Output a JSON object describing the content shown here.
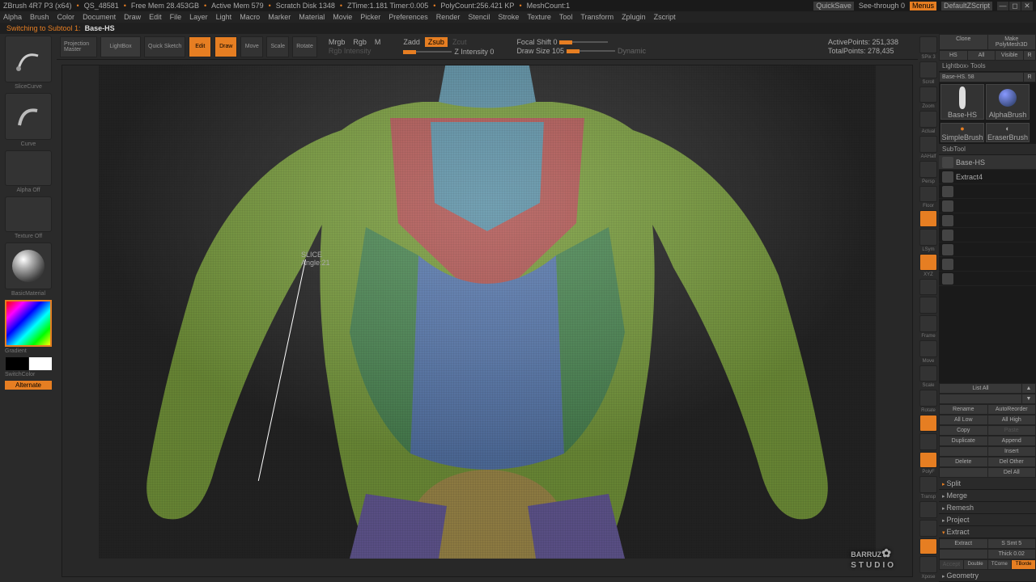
{
  "titlebar": {
    "app": "ZBrush 4R7 P3 (x64)",
    "doc": "QS_48581",
    "free_mem": "Free Mem 28.453GB",
    "active_mem": "Active Mem 579",
    "scratch": "Scratch Disk 1348",
    "ztime": "ZTime:1.181 Timer:0.005",
    "polycount": "PolyCount:256.421 KP",
    "meshcount": "MeshCount:1",
    "quicksave": "QuickSave",
    "seethrough": "See-through  0",
    "menus": "Menus",
    "script": "DefaultZScript"
  },
  "menus": [
    "Alpha",
    "Brush",
    "Color",
    "Document",
    "Draw",
    "Edit",
    "File",
    "Layer",
    "Light",
    "Macro",
    "Marker",
    "Material",
    "Movie",
    "Picker",
    "Preferences",
    "Render",
    "Stencil",
    "Stroke",
    "Texture",
    "Tool",
    "Transform",
    "Zplugin",
    "Zscript"
  ],
  "status": {
    "prefix": "Switching to Subtool 1:",
    "name": "Base-HS"
  },
  "toolbar": {
    "projection": "Projection\nMaster",
    "lightbox": "LightBox",
    "quicksketch": "Quick\nSketch",
    "edit": "Edit",
    "draw": "Draw",
    "move": "Move",
    "scale": "Scale",
    "rotate": "Rotate",
    "mrgb": "Mrgb",
    "rgb": "Rgb",
    "m": "M",
    "zadd": "Zadd",
    "zsub": "Zsub",
    "zcut": "Zcut",
    "rgb_int": "Rgb Intensity",
    "z_int": "Z Intensity 0",
    "focal": "Focal Shift 0",
    "drawsize": "Draw Size 105",
    "dynamic": "Dynamic",
    "active_pts": "ActivePoints: 251,338",
    "total_pts": "TotalPoints: 278,435"
  },
  "viewport": {
    "slice": "SLICE",
    "angle": "Angle:21"
  },
  "left": {
    "slicecurve": "SliceCurve",
    "curve": "Curve",
    "alpha_off": "Alpha Off",
    "texture_off": "Texture Off",
    "material": "BasicMaterial",
    "gradient": "Gradient",
    "switchcolor": "SwitchColor",
    "alternate": "Alternate"
  },
  "rightstrip": {
    "labels": [
      "SPix 3",
      "Scroll",
      "Zoom",
      "Actual",
      "AAHalf",
      "Persp",
      "Floor",
      "",
      "LSym",
      "XYZ",
      "",
      "",
      "Frame",
      "Move",
      "Scale",
      "Rotate",
      "",
      "",
      "PolyF",
      "Transp",
      "",
      "",
      "",
      "Xpose"
    ]
  },
  "panel": {
    "toprow": [
      "Clone",
      "Make PolyMesh3D"
    ],
    "filterrow": [
      "HS",
      "All",
      "Visible",
      "R"
    ],
    "toolsheader": "Lightbox› Tools",
    "basehs": "Base-HS. 58",
    "r": "R",
    "thumb1": "Base-HS",
    "thumb2": "AlphaBrush",
    "thumb3": "SimpleBrush",
    "thumb4": "EraserBrush",
    "subtool_hdr": "SubTool",
    "subtools": [
      "Base-HS",
      "Extract4",
      "",
      "",
      "",
      "",
      "",
      "",
      ""
    ],
    "listall": "List All",
    "btns": {
      "rename": "Rename",
      "autoreorder": "AutoReorder",
      "alllow": "All Low",
      "allhigh": "All High",
      "copy": "Copy",
      "paste": "Paste",
      "duplicate": "Duplicate",
      "append": "Append",
      "insert": "Insert",
      "delete": "Delete",
      "delother": "Del Other",
      "delall": "Del All",
      "split": "Split",
      "merge": "Merge",
      "remesh": "Remesh",
      "project": "Project",
      "extract_hdr": "Extract",
      "extract": "Extract",
      "ssmt": "S Smt 5",
      "thick": "Thick 0.02",
      "accept": "Accept",
      "double": "Double",
      "tcorne": "TCorne",
      "tborde": "TBorde",
      "geometry": "Geometry"
    }
  },
  "watermark": {
    "main": "BARRUZ",
    "sub": "STUDIO"
  }
}
